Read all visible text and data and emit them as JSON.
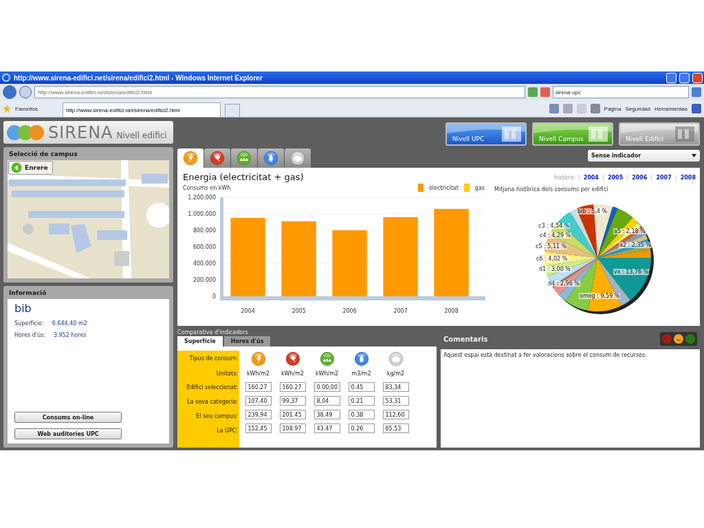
{
  "browser": {
    "title": "http://www.sirena-edifici.net/sirena/edifici2.html - Windows Internet Explorer",
    "address": "http://www.sirena-edifici.net/sirena/edifici2.html",
    "search": "sirena upc",
    "favorites": "Favoritos",
    "tab": "http://www.sirena-edifici.net/sirena/edifici2.html",
    "menus": [
      "Página",
      "Seguridad",
      "Herramientas"
    ]
  },
  "logo": {
    "name": "SIRENA",
    "subtitle": "Nivell edifici"
  },
  "levels": [
    {
      "label": "Nivell UPC",
      "selected": false
    },
    {
      "label": "Nivell Campus",
      "selected": false
    },
    {
      "label": "Nivell Edifici",
      "selected": true
    }
  ],
  "campus": {
    "title": "Selecció de campus",
    "back_button": "Enrere"
  },
  "info": {
    "title": "Informació",
    "building": "bib",
    "fields": [
      {
        "label": "Superfície:",
        "value": "6.644,40 m2"
      },
      {
        "label": "Hores d'ús:",
        "value": "3.952 hores"
      }
    ],
    "buttons": [
      "Consums on-line",
      "Web auditories UPC"
    ]
  },
  "resource_tabs": [
    {
      "kind": "electricity",
      "selected": true
    },
    {
      "kind": "power",
      "selected": false
    },
    {
      "kind": "heating",
      "selected": false
    },
    {
      "kind": "water",
      "selected": false
    },
    {
      "kind": "co2",
      "selected": false
    }
  ],
  "indicator_select": "Sense indicador",
  "energy": {
    "title": "Energia (electricitat + gas)",
    "chart_data": {
      "type": "bar",
      "ylabel": "Consums en kWh",
      "categories": [
        "2004",
        "2005",
        "2006",
        "2007",
        "2008"
      ],
      "stacked": true,
      "grid": true,
      "ylim": [
        0,
        1200000
      ],
      "yticks": [
        {
          "value": 0,
          "label": "0"
        },
        {
          "value": 200000,
          "label": "200.000"
        },
        {
          "value": 400000,
          "label": "400.000"
        },
        {
          "value": 600000,
          "label": "600.000"
        },
        {
          "value": 800000,
          "label": "800.000"
        },
        {
          "value": 1000000,
          "label": "1.000.000"
        },
        {
          "value": 1200000,
          "label": "1.200.000"
        }
      ],
      "series": [
        {
          "name": "electricitat",
          "color": "#ff9900",
          "values": [
            950000,
            910000,
            800000,
            960000,
            1060000
          ]
        },
        {
          "name": "gas",
          "color": "#ffcc00",
          "values": [
            0,
            0,
            0,
            0,
            0
          ]
        }
      ]
    }
  },
  "history": {
    "links": [
      {
        "label": "històric",
        "selected": true
      },
      {
        "label": "2004",
        "selected": false
      },
      {
        "label": "2005",
        "selected": false
      },
      {
        "label": "2006",
        "selected": false
      },
      {
        "label": "2007",
        "selected": false
      },
      {
        "label": "2008",
        "selected": false
      }
    ],
    "subtitle": "Mitjana històrica dels consums per edifici",
    "slice_labels": [
      "bib : 5,4 %",
      "c3 : 4,54 %",
      "a5 : 2,18 %",
      "c4 : 4,29 %",
      "a2 : 2,35 %",
      "c5 : 5,11 %",
      "c6 : 4,02 %",
      "d1 : 3,00 %",
      "vx : 13,76 %",
      "d4 : 2,96 %",
      "omeg : 9,59 %"
    ]
  },
  "comparison": {
    "title": "Comparativa d'indicadors",
    "tabs": [
      {
        "label": "Superfície",
        "selected": true
      },
      {
        "label": "Hores d'ús",
        "selected": false
      }
    ],
    "row_labels": [
      "Tipus de consum:",
      "Unitats:",
      "Edifici seleccionat:",
      "La seva categoria:",
      "El seu campus:",
      "La UPC:"
    ],
    "columns": [
      {
        "kind": "electricity",
        "unit": "kWh/m2",
        "values": [
          "160,27",
          "107,40",
          "239,94",
          "152,45"
        ]
      },
      {
        "kind": "power",
        "unit": "kWh/m2",
        "values": [
          "160.27",
          "99,37",
          "201.45",
          "108.97"
        ]
      },
      {
        "kind": "heating",
        "unit": "kWh/m2",
        "values": [
          "0.00,00",
          "8,04",
          "38,49",
          "43.47"
        ]
      },
      {
        "kind": "water",
        "unit": "m3/m2",
        "values": [
          "0.45",
          "0.21",
          "0.38",
          "0.26"
        ]
      },
      {
        "kind": "co2",
        "unit": "kg/m2",
        "values": [
          "83,34",
          "53,31",
          "112,60",
          "65,53"
        ]
      }
    ]
  },
  "comments": {
    "title": "Comentaris",
    "text": "Aquest espai està destinat a fer valoracions sobre el consum de recursos."
  }
}
